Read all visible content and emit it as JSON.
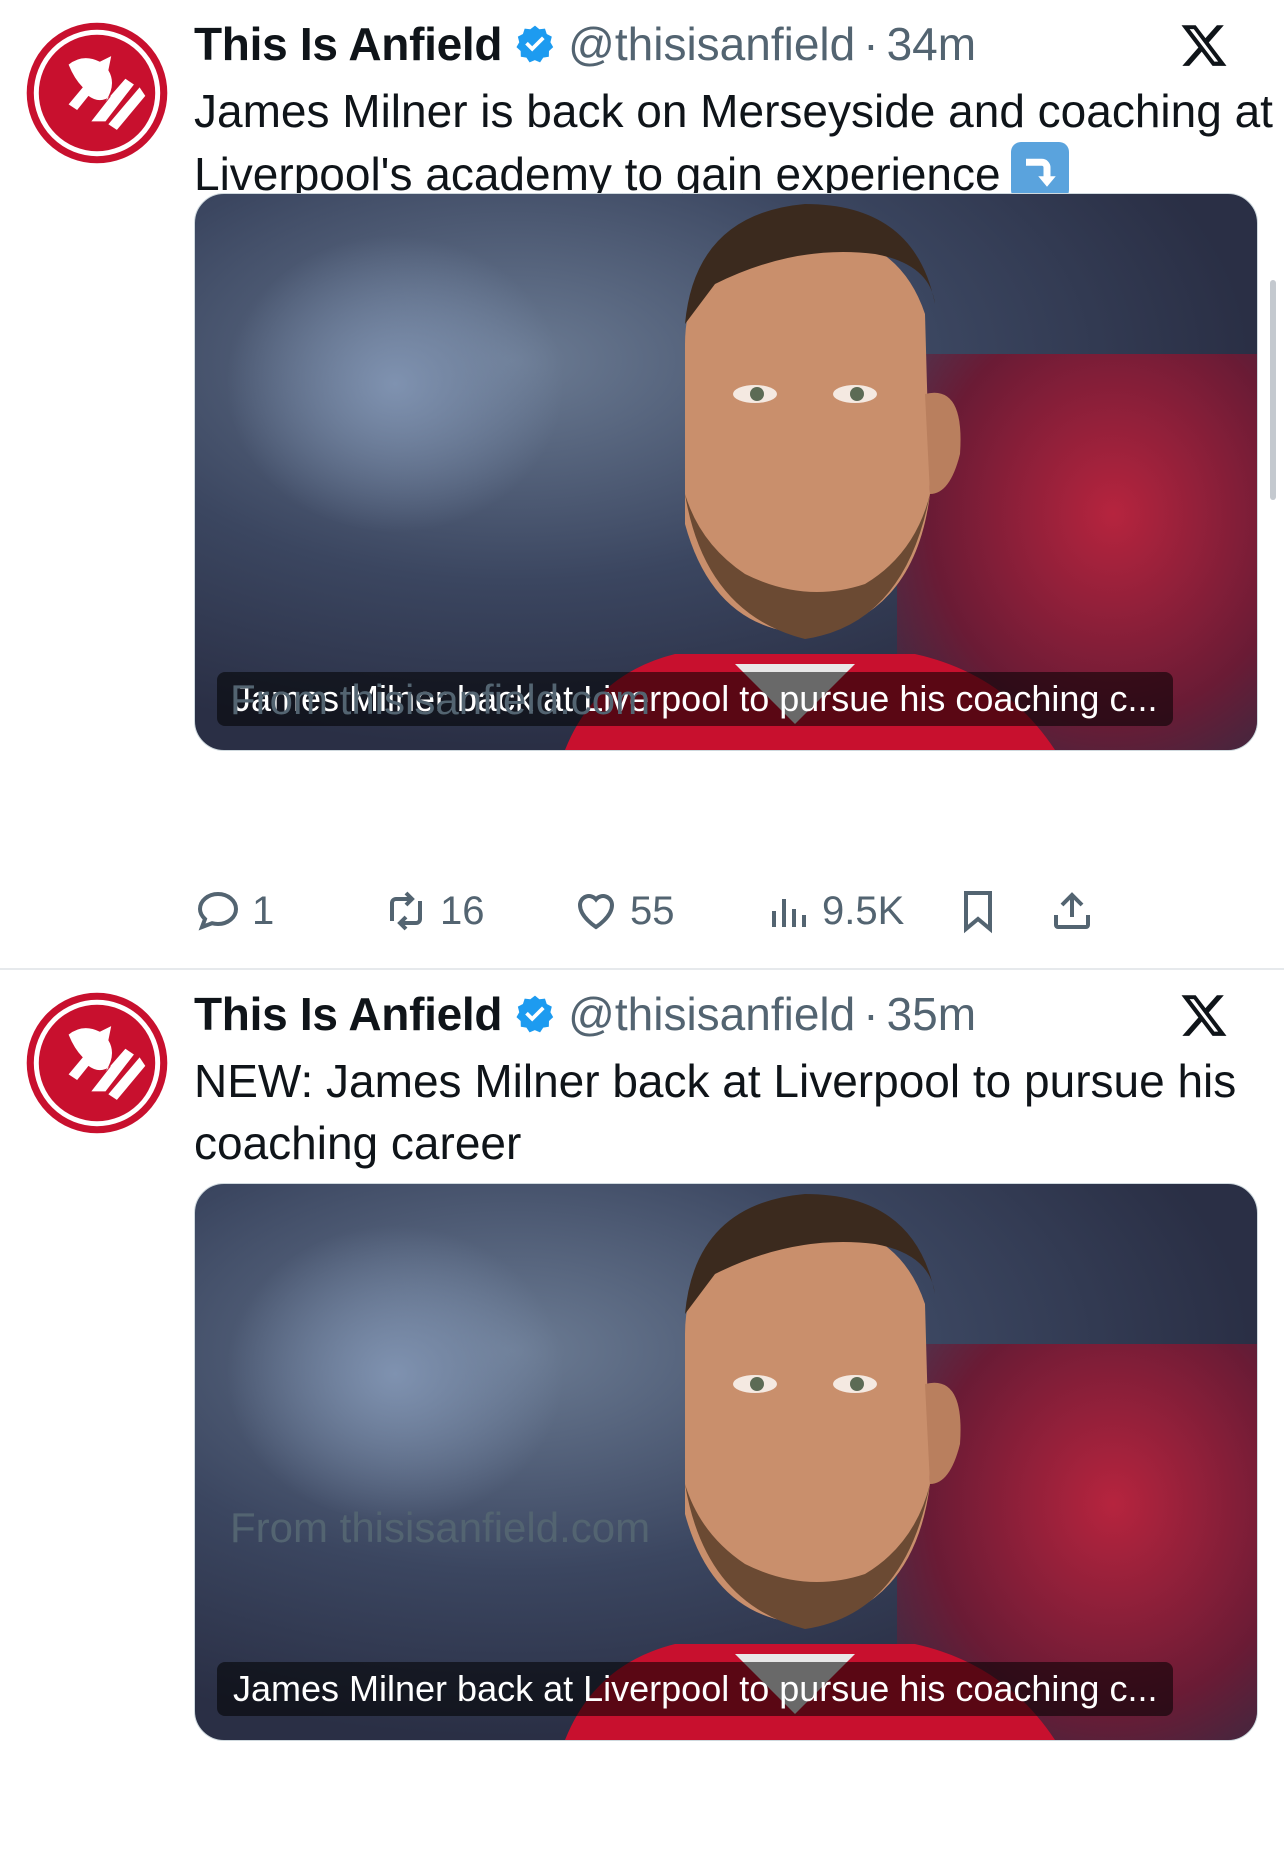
{
  "tweets": [
    {
      "account_name": "This Is Anfield",
      "handle": "@thisisanfield",
      "separator": "·",
      "time": "34m",
      "text": "James Milner is back on Merseyside and coaching at Liverpool's academy to gain experience",
      "card_caption": "James Milner back at Liverpool to pursue his coaching c...",
      "card_source": "From thisisanfield.com",
      "stats": {
        "replies": "1",
        "reposts": "16",
        "likes": "55",
        "views": "9.5K"
      }
    },
    {
      "account_name": "This Is Anfield",
      "handle": "@thisisanfield",
      "separator": "·",
      "time": "35m",
      "text": "NEW: James Milner back at Liverpool to pursue his coaching career",
      "card_caption": "James Milner back at Liverpool to pursue his coaching c...",
      "card_source": "From thisisanfield.com"
    }
  ],
  "icons": {
    "verified": "verified-badge-icon",
    "x_logo": "x-logo-icon",
    "arrow_emoji": "right-arrow-curving-down-icon",
    "reply": "reply-icon",
    "repost": "repost-icon",
    "like": "heart-icon",
    "views": "views-icon",
    "bookmark": "bookmark-icon",
    "share": "share-icon"
  },
  "colors": {
    "verified_blue": "#1d9bf0",
    "brand_red": "#c8102e",
    "secondary_text": "#536471"
  }
}
